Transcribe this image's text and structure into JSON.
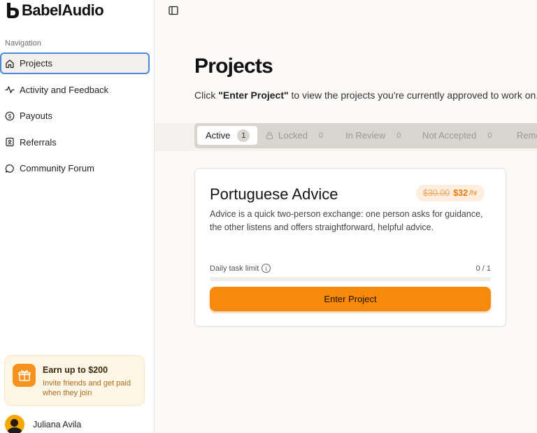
{
  "app": {
    "logo_text": "BabelAudio"
  },
  "sidebar": {
    "heading": "Navigation",
    "items": [
      {
        "label": "Projects",
        "icon": "home-icon",
        "active": true
      },
      {
        "label": "Activity and Feedback",
        "icon": "activity-icon"
      },
      {
        "label": "Payouts",
        "icon": "dollar-circle-icon"
      },
      {
        "label": "Referrals",
        "icon": "id-badge-icon"
      },
      {
        "label": "Community Forum",
        "icon": "chat-bubble-icon"
      }
    ],
    "promo": {
      "title": "Earn up to $200",
      "subtitle": "Invite friends and get paid when they join",
      "icon": "gift-icon"
    },
    "user": {
      "name": "Juliana Avila"
    }
  },
  "main": {
    "title": "Projects",
    "subtitle_prefix": "Click ",
    "subtitle_bold": "\"Enter Project\"",
    "subtitle_suffix": " to view the projects you're currently approved to work on.",
    "tabs": [
      {
        "label": "Active",
        "count": "1"
      },
      {
        "label": "Locked",
        "count": "0"
      },
      {
        "label": "In Review",
        "count": "0"
      },
      {
        "label": "Not Accepted",
        "count": "0"
      },
      {
        "label": "Removed"
      }
    ],
    "card": {
      "title": "Portuguese Advice",
      "old_price": "$30.00",
      "new_price": "$32",
      "unit": "/hr",
      "description": "Advice is a quick two-person exchange: one person asks for guidance, the other listens and offers straightforward, helpful advice.",
      "limit_label": "Daily task limit",
      "limit_value": "0 / 1",
      "limit_progress": 0,
      "button_label": "Enter Project"
    }
  },
  "colors": {
    "accent": "#f88a0b",
    "focus_ring": "#4a89dc",
    "promo_bg": "#fdf6e6"
  }
}
